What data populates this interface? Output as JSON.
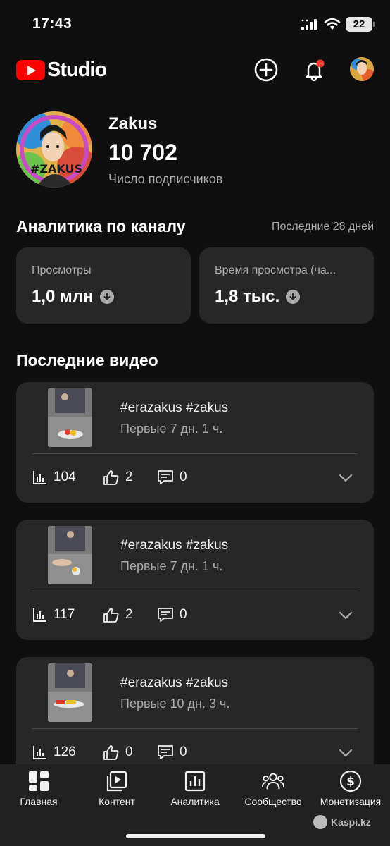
{
  "status_bar": {
    "time": "17:43",
    "battery": "22"
  },
  "header": {
    "logo_text": "Studio",
    "icons": [
      "create-icon",
      "bell-icon",
      "avatar"
    ],
    "notification_color": "#ff3b30"
  },
  "channel": {
    "name": "Zakus",
    "subscribers": "10 702",
    "subscribers_label": "Число подписчиков",
    "avatar_text": "#ZAKUS"
  },
  "analytics": {
    "title": "Аналитика по каналу",
    "period": "Последние 28 дней",
    "cards": [
      {
        "label": "Просмотры",
        "value": "1,0 млн"
      },
      {
        "label": "Время просмотра (ча...",
        "value": "1,8 тыс."
      }
    ]
  },
  "recent": {
    "title": "Последние видео",
    "videos": [
      {
        "title": "#erazakus #zakus",
        "subtitle": "Первые 7 дн. 1 ч.",
        "views": "104",
        "likes": "2",
        "comments": "0"
      },
      {
        "title": "#erazakus #zakus",
        "subtitle": "Первые 7 дн. 1 ч.",
        "views": "117",
        "likes": "2",
        "comments": "0"
      },
      {
        "title": "#erazakus #zakus",
        "subtitle": "Первые 10 дн. 3 ч.",
        "views": "126",
        "likes": "0",
        "comments": "0"
      }
    ]
  },
  "bottom_nav": [
    {
      "label": "Главная",
      "icon": "dashboard-icon"
    },
    {
      "label": "Контент",
      "icon": "content-icon"
    },
    {
      "label": "Аналитика",
      "icon": "analytics-icon"
    },
    {
      "label": "Сообщество",
      "icon": "community-icon"
    },
    {
      "label": "Монетизация",
      "icon": "monetization-icon"
    }
  ],
  "watermark": "Kaspi.kz",
  "colors": {
    "background": "#0f0f0f",
    "card": "#272727",
    "brand_red": "#ff0000",
    "muted_text": "#aaaaaa"
  }
}
